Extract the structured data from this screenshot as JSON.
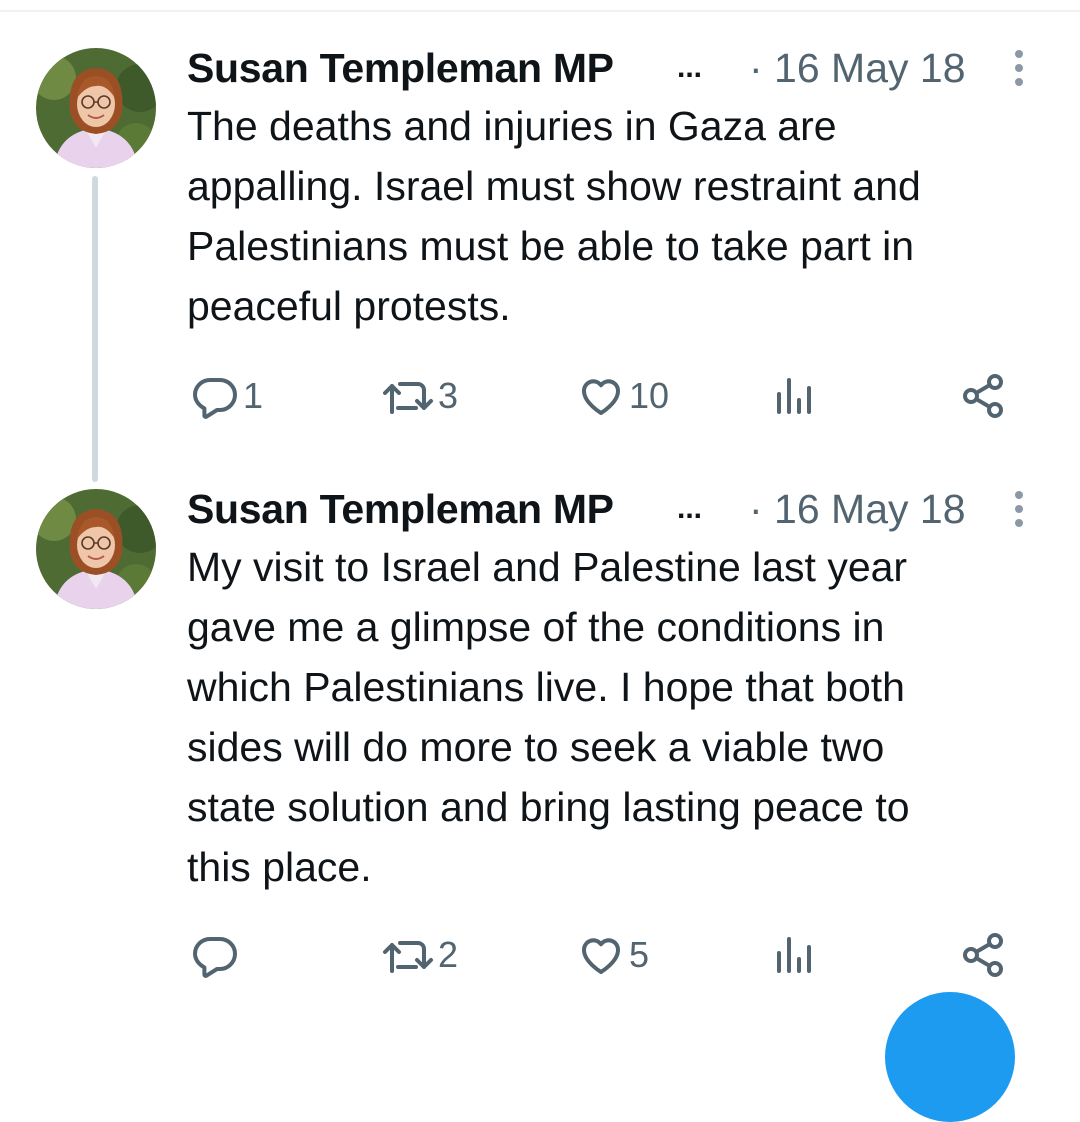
{
  "colors": {
    "text": "#0f1419",
    "secondary": "#536471",
    "accent": "#1d9bf0",
    "thread_line": "#cfd9de"
  },
  "tweets": [
    {
      "author": "Susan Templeman MP",
      "truncation": "...",
      "date": "· 16 May 18",
      "text_lines": [
        "The deaths and injuries in Gaza are",
        "appalling. Israel must show restraint and",
        "Palestinians must be able to take part in",
        "peaceful protests."
      ],
      "replies": "1",
      "retweets": "3",
      "likes": "10",
      "icons": [
        "reply-icon",
        "retweet-icon",
        "like-icon",
        "views-icon",
        "share-icon",
        "more-icon"
      ]
    },
    {
      "author": "Susan Templeman MP",
      "truncation": "...",
      "date": "· 16 May 18",
      "text_lines": [
        "My visit to Israel and Palestine last year",
        "gave me a glimpse of the conditions in",
        "which Palestinians live. I hope that both",
        "sides will do more to seek a viable two",
        "state solution and bring lasting peace to",
        "this place."
      ],
      "replies": "",
      "retweets": "2",
      "likes": "5",
      "icons": [
        "reply-icon",
        "retweet-icon",
        "like-icon",
        "views-icon",
        "share-icon",
        "more-icon"
      ]
    }
  ]
}
